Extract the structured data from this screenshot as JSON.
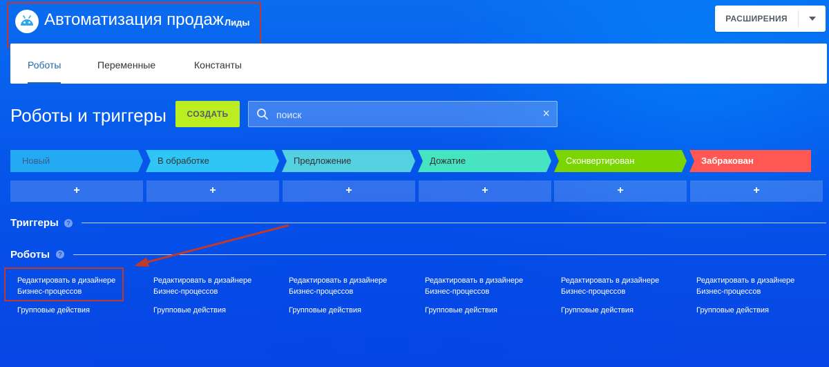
{
  "header": {
    "title": "Автоматизация продаж",
    "subtitle": "Лиды",
    "extensions_label": "РАСШИРЕНИЯ"
  },
  "tabs": [
    {
      "label": "Роботы",
      "active": true
    },
    {
      "label": "Переменные",
      "active": false
    },
    {
      "label": "Константы",
      "active": false
    }
  ],
  "section": {
    "title": "Роботы и триггеры",
    "create_label": "СОЗДАТЬ",
    "search_placeholder": "поиск"
  },
  "stages": [
    {
      "label": "Новый",
      "color": "#2fc6f6"
    },
    {
      "label": "В обработке",
      "color": "#2fc6f6"
    },
    {
      "label": "Предложение",
      "color": "#55d0e0"
    },
    {
      "label": "Дожатие",
      "color": "#47e4c2"
    },
    {
      "label": "Сконвертирован",
      "color": "#7bd500"
    },
    {
      "label": "Забракован",
      "color": "#ff5752"
    }
  ],
  "add_label": "+",
  "triggers_label": "Триггеры",
  "robots_label": "Роботы",
  "help_glyph": "?",
  "robot_actions": {
    "edit_line1": "Редактировать в дизайнере",
    "edit_line2": "Бизнес-процессов",
    "group": "Групповые действия"
  }
}
